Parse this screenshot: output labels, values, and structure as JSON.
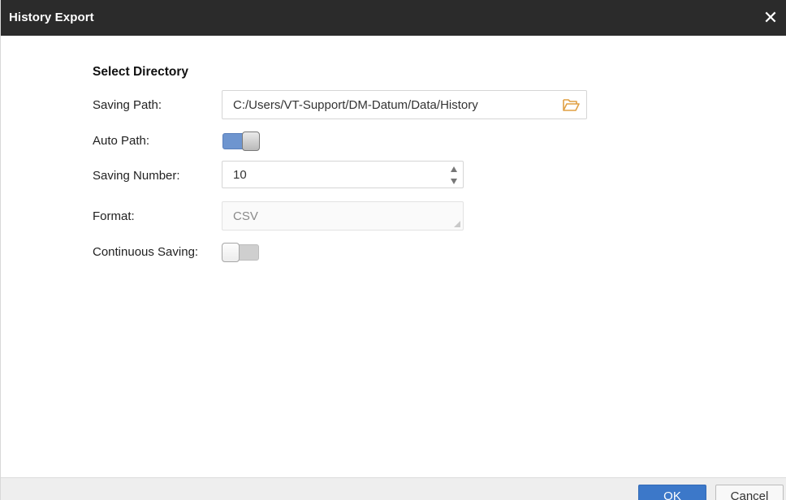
{
  "dialog": {
    "title": "History Export",
    "close_icon": "close-icon"
  },
  "section": {
    "title": "Select Directory"
  },
  "saving_path": {
    "label": "Saving Path:",
    "value": "C:/Users/VT-Support/DM-Datum/Data/History",
    "icon": "folder-open-icon"
  },
  "auto_path": {
    "label": "Auto Path:",
    "state": "on"
  },
  "saving_number": {
    "label": "Saving Number:",
    "value": "10"
  },
  "format": {
    "label": "Format:",
    "value": "CSV"
  },
  "continuous_saving": {
    "label": "Continuous Saving:",
    "state": "off"
  },
  "footer": {
    "ok_label": "OK",
    "cancel_label": "Cancel"
  },
  "colors": {
    "titlebar": "#2b2b2b",
    "toggle_on": "#6e95cf",
    "primary_button": "#3c78c9",
    "folder_icon": "#e0a044"
  }
}
